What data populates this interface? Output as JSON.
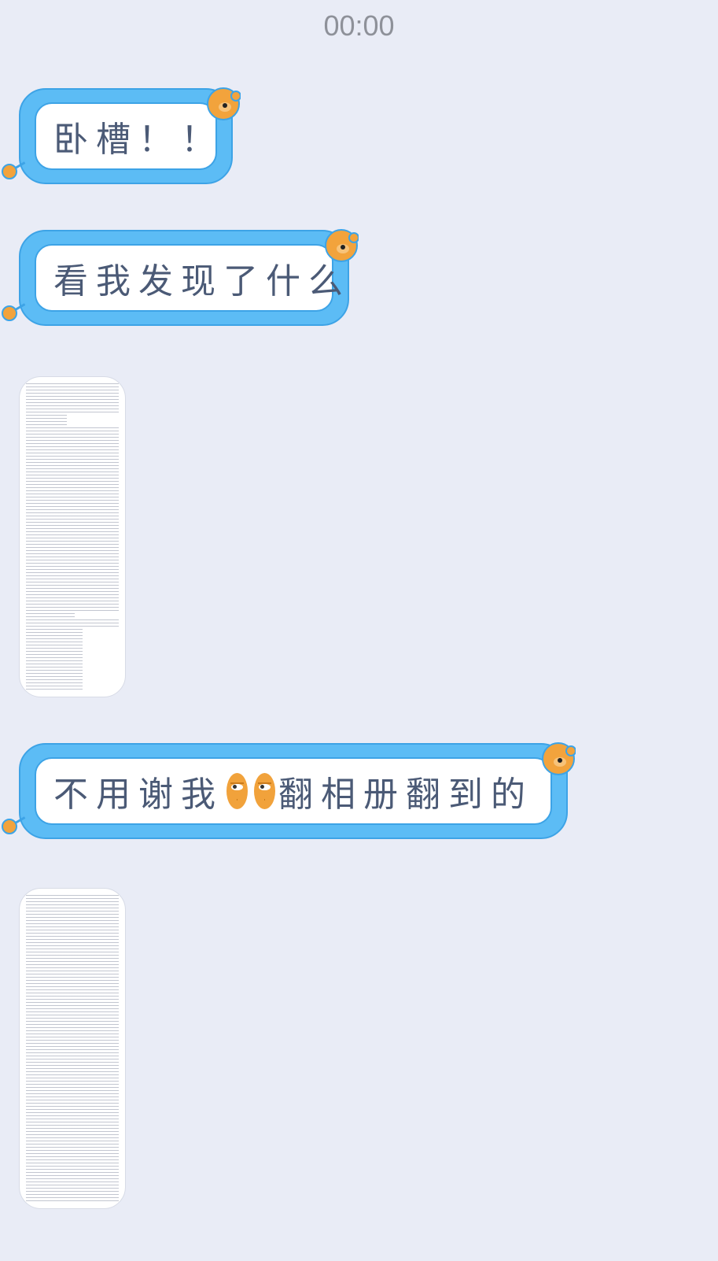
{
  "status": {
    "time": "00:00"
  },
  "messages": [
    {
      "type": "text",
      "text": "卧槽！！"
    },
    {
      "type": "text",
      "text": "看我发现了什么"
    },
    {
      "type": "image",
      "description": "long-text-screenshot"
    },
    {
      "type": "text",
      "parts": [
        "不用谢我",
        "翻相册翻到的"
      ],
      "emoji": [
        "smirk-emoji",
        "smirk-emoji"
      ]
    },
    {
      "type": "image",
      "description": "long-text-screenshot"
    }
  ],
  "colors": {
    "background": "#e9ecf6",
    "bubble": "#5cbcf5",
    "bubble_border": "#3da3e6",
    "bear": "#f2a33c",
    "text": "#4b5a76"
  }
}
